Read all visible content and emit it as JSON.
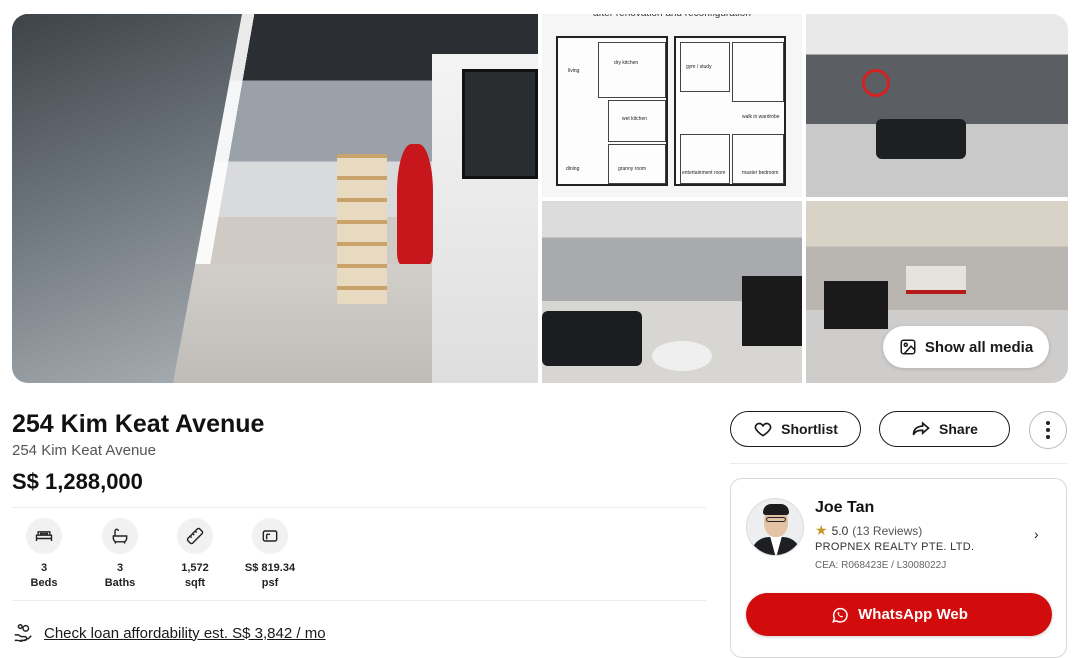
{
  "gallery": {
    "floorplan_caption": "after renovation and reconfiguration",
    "floorplan_rooms": {
      "living": "living",
      "dry_kitchen": "dry kitchen",
      "wet_kitchen": "wet kitchen",
      "dining": "dining",
      "granny_room": "granny room",
      "gym_study": "gym / study",
      "walk_in_wardrobe": "walk in wardrobe",
      "entertainment_room": "entertainment room",
      "master_bedroom": "master bedroom"
    },
    "show_all_label": "Show all media"
  },
  "listing": {
    "title": "254 Kim Keat Avenue",
    "address": "254 Kim Keat Avenue",
    "price": "S$ 1,288,000"
  },
  "specs": [
    {
      "value": "3",
      "label": "Beds",
      "icon": "bed-icon"
    },
    {
      "value": "3",
      "label": "Baths",
      "icon": "bath-icon"
    },
    {
      "value": "1,572",
      "label": "sqft",
      "icon": "ruler-icon"
    },
    {
      "value": "S$ 819.34",
      "label": "psf",
      "icon": "price-tag-icon"
    }
  ],
  "loan": {
    "text": "Check loan affordability est. S$ 3,842 / mo"
  },
  "actions": {
    "shortlist_label": "Shortlist",
    "share_label": "Share"
  },
  "agent": {
    "name": "Joe Tan",
    "rating": "5.0",
    "reviews": "(13 Reviews)",
    "agency": "PROPNEX REALTY PTE. LTD.",
    "cea": "CEA: R068423E / L3008022J",
    "whatsapp_label": "WhatsApp Web"
  },
  "colors": {
    "whatsapp_button": "#d20c0c",
    "star": "#c9962b"
  }
}
